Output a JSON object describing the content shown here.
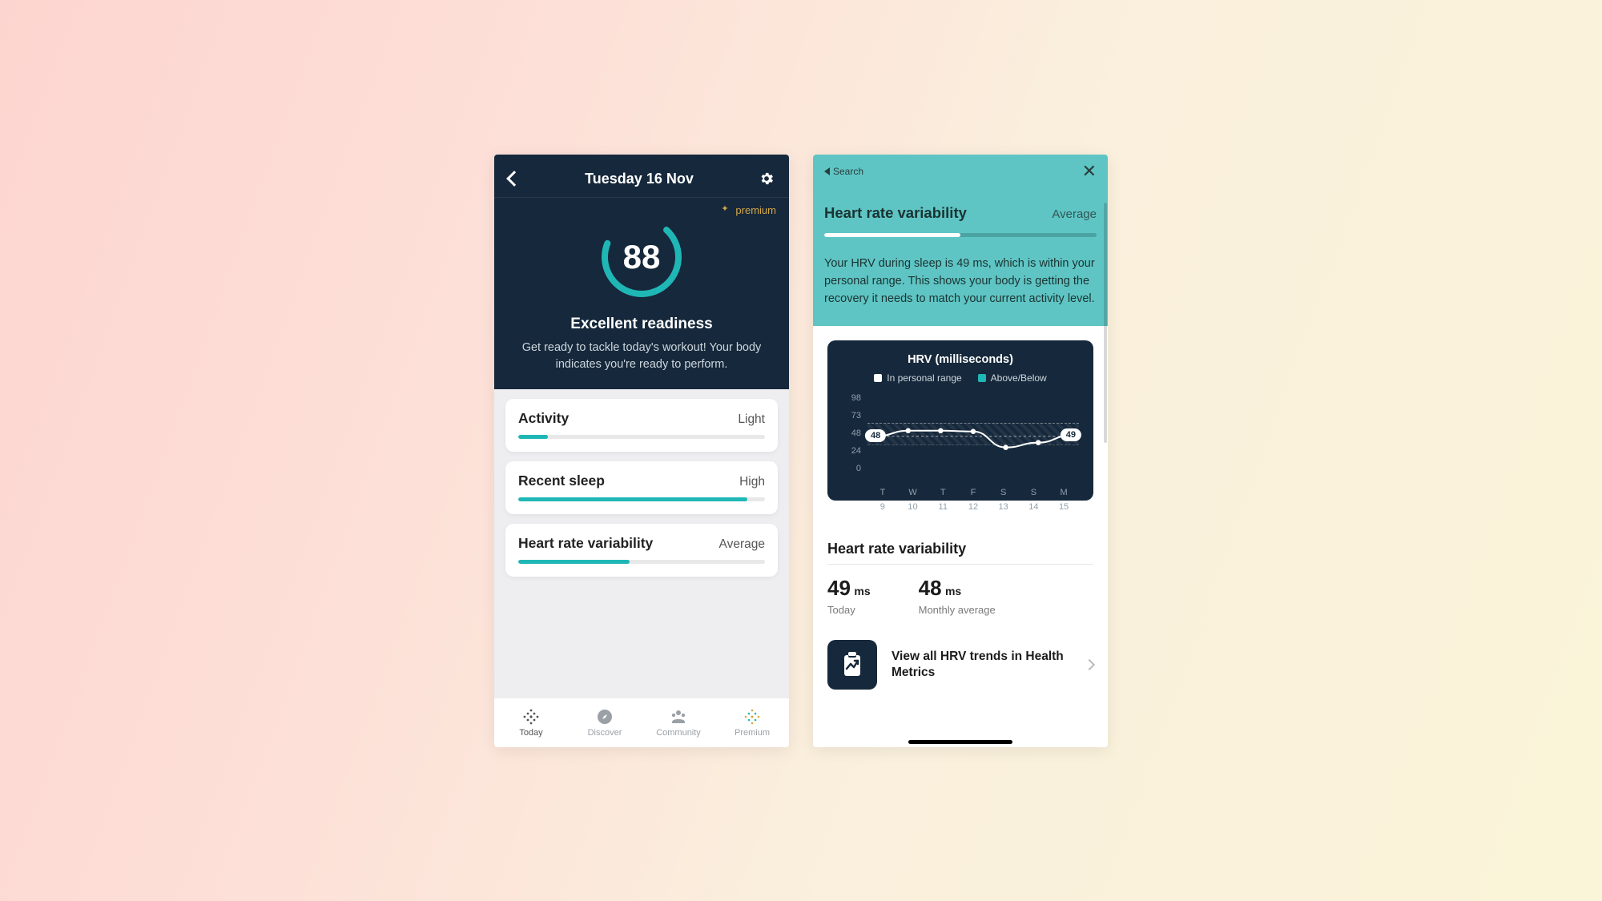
{
  "phone1": {
    "nav_title": "Tuesday 16 Nov",
    "premium_label": "premium",
    "score": "88",
    "readiness_title": "Excellent readiness",
    "readiness_sub": "Get ready to tackle today's workout! Your body indicates you're ready to perform.",
    "cards": [
      {
        "title": "Activity",
        "value": "Light",
        "pct": 12
      },
      {
        "title": "Recent sleep",
        "value": "High",
        "pct": 93
      },
      {
        "title": "Heart rate variability",
        "value": "Average",
        "pct": 45
      }
    ],
    "tabs": [
      {
        "label": "Today",
        "icon": "diamond-dots-icon",
        "active": true
      },
      {
        "label": "Discover",
        "icon": "compass-icon",
        "active": false
      },
      {
        "label": "Community",
        "icon": "people-icon",
        "active": false
      },
      {
        "label": "Premium",
        "icon": "sparkle-icon",
        "active": false
      }
    ]
  },
  "phone2": {
    "back_label": "Search",
    "header_title": "Heart rate variability",
    "header_value": "Average",
    "header_bar_pct": 50,
    "header_text": "Your HRV during sleep is 49 ms, which is within your personal range. This shows your body is getting the recovery it needs to match your current activity level.",
    "chart_title": "HRV (milliseconds)",
    "legend1": "In personal range",
    "legend2": "Above/Below",
    "section_title": "Heart rate variability",
    "today_value": "49",
    "today_unit": "ms",
    "today_label": "Today",
    "month_value": "48",
    "month_unit": "ms",
    "month_label": "Monthly average",
    "trend_text": "View all HRV trends in Health Metrics",
    "badge_start": "48",
    "badge_end": "49"
  },
  "chart_data": {
    "type": "line",
    "title": "HRV (milliseconds)",
    "ylabel": "",
    "ylim": [
      0,
      98
    ],
    "y_ticks": [
      98,
      73,
      48,
      24,
      0
    ],
    "personal_range": [
      36,
      64
    ],
    "categories": [
      "T",
      "W",
      "T",
      "F",
      "S",
      "S",
      "M"
    ],
    "dates": [
      "9",
      "10",
      "11",
      "12",
      "13",
      "14",
      "15"
    ],
    "series": [
      {
        "name": "In personal range",
        "values": [
          48,
          55,
          55,
          54,
          34,
          40,
          49
        ]
      }
    ],
    "legend": [
      "In personal range",
      "Above/Below"
    ]
  }
}
